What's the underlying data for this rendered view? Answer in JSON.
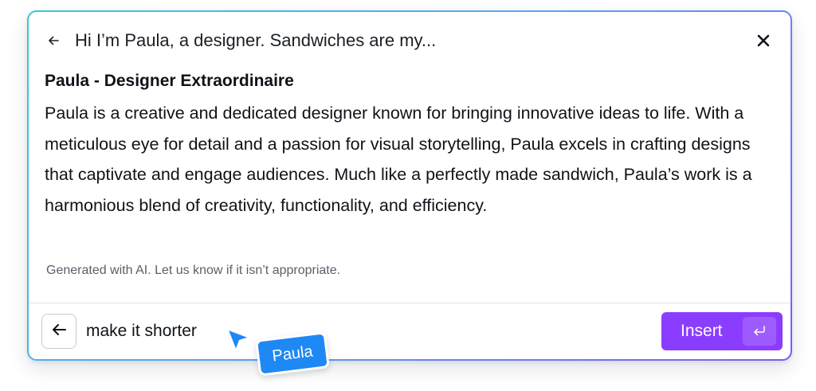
{
  "header": {
    "title": "Hi I’m Paula, a designer. Sandwiches are my..."
  },
  "bio": {
    "heading": "Paula - Designer Extraordinaire",
    "body": "Paula is a creative and dedicated designer known for bringing innovative ideas to life. With a meticulous eye for detail and a passion for visual storytelling, Paula excels in crafting designs that captivate and engage audiences. Much like a perfectly made sandwich, Paula’s work is a harmonious blend of creativity, functionality, and efficiency."
  },
  "disclaimer": "Generated with AI. Let us know if it isn’t appropriate.",
  "prompt": {
    "value": "make it shorter"
  },
  "insert_button": {
    "label": "Insert"
  },
  "collaborator": {
    "name": "Paula"
  },
  "colors": {
    "accent": "#8b3dff",
    "cursor": "#1e88f5",
    "border_gradient_start": "#37c9d6",
    "border_gradient_end": "#7d5bf0"
  },
  "icons": {
    "header_back": "arrow-left-icon",
    "close": "close-icon",
    "footer_back": "arrow-left-icon",
    "enter": "enter-key-icon",
    "cursor": "mouse-pointer-icon"
  }
}
